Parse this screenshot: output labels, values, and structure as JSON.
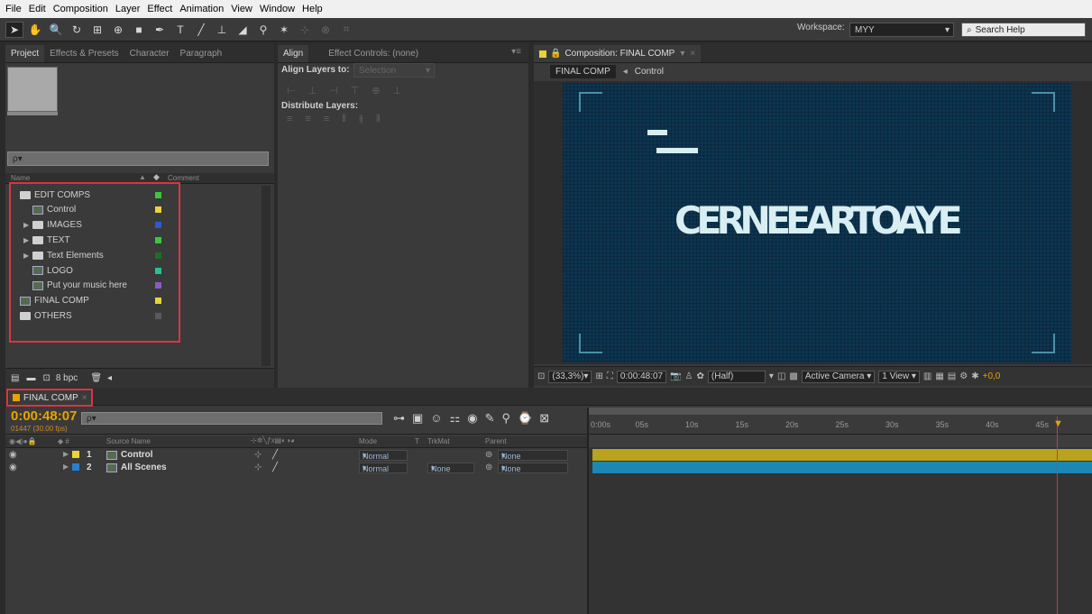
{
  "menu": [
    "File",
    "Edit",
    "Composition",
    "Layer",
    "Effect",
    "Animation",
    "View",
    "Window",
    "Help"
  ],
  "toolbar": {
    "workspace_label": "Workspace:",
    "workspace_value": "MYY",
    "search_placeholder": "Search Help"
  },
  "project_panel": {
    "tabs": [
      "Project",
      "Effects & Presets",
      "Character",
      "Paragraph"
    ],
    "search_placeholder": "",
    "search_glyph": "ρ▾",
    "col_name": "Name",
    "col_comment": "Comment",
    "items": [
      {
        "label": "EDIT COMPS",
        "type": "folder",
        "color": "#3cc83c"
      },
      {
        "label": "Control",
        "type": "comp",
        "color": "#e8d43a"
      },
      {
        "label": "IMAGES",
        "type": "folder",
        "color": "#2a5bd0"
      },
      {
        "label": "TEXT",
        "type": "folder",
        "color": "#3cc83c"
      },
      {
        "label": "Text Elements",
        "type": "folder",
        "color": "#1e6e2a"
      },
      {
        "label": "LOGO",
        "type": "comp",
        "color": "#26c28e"
      },
      {
        "label": "Put your music here",
        "type": "comp",
        "color": "#8a5cc0"
      },
      {
        "label": "FINAL COMP",
        "type": "comp",
        "color": "#e8d43a"
      },
      {
        "label": "OTHERS",
        "type": "folder",
        "color": "#5a5a5a"
      }
    ],
    "footer_bpc": "8 bpc"
  },
  "align_panel": {
    "tabs": [
      "Align",
      "Effect Controls: (none)"
    ],
    "align_layers_to": "Align Layers to:",
    "selection": "Selection",
    "distribute_layers": "Distribute Layers:"
  },
  "comp_panel": {
    "tab": "Composition: FINAL COMP",
    "breadcrumb": [
      "FINAL COMP",
      "Control"
    ],
    "logo_text": "CERNEEARTOAYE",
    "footer": {
      "zoom": "(33,3%)",
      "timecode": "0:00:48:07",
      "resolution": "(Half)",
      "camera": "Active Camera",
      "view": "1 View",
      "exposure": "+0,0"
    }
  },
  "timeline": {
    "tab": "FINAL COMP",
    "timecode": "0:00:48:07",
    "frames": "01447 (30.00 fps)",
    "search_glyph": "ρ▾",
    "headers": {
      "source_name": "Source Name",
      "mode": "Mode",
      "t": "T",
      "trkmat": "TrkMat",
      "parent": "Parent"
    },
    "ruler": [
      "0:00s",
      "05s",
      "10s",
      "15s",
      "20s",
      "25s",
      "30s",
      "35s",
      "40s",
      "45s"
    ],
    "layers": [
      {
        "num": "1",
        "name": "Control",
        "color": "#e8d43a",
        "mode": "Normal",
        "trkmat": "",
        "parent": "None",
        "bar": "#b8a21e"
      },
      {
        "num": "2",
        "name": "All Scenes",
        "color": "#2a7fd0",
        "mode": "Normal",
        "trkmat": "None",
        "parent": "None",
        "bar": "#1b87b3"
      }
    ],
    "playhead_fraction": 0.93
  }
}
